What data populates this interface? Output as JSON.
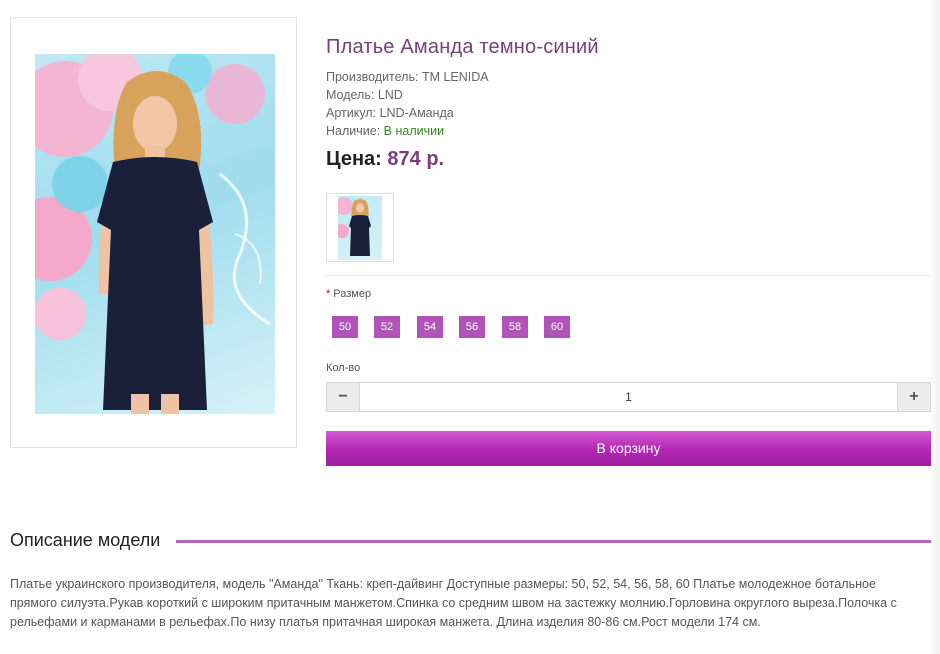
{
  "product": {
    "title": "Платье Аманда темно-синий",
    "specs": [
      {
        "label": "Производитель:",
        "value": "TM LENIDA"
      },
      {
        "label": "Модель:",
        "value": "LND"
      },
      {
        "label": "Артикул:",
        "value": "LND-Аманда"
      },
      {
        "label": "Наличие:",
        "value": "В наличии"
      }
    ],
    "price_label": "Цена:",
    "price_value": "874 р.",
    "size_label": "Размер",
    "sizes": [
      "50",
      "52",
      "54",
      "56",
      "58",
      "60"
    ],
    "qty_label": "Кол-во",
    "qty_value": "1",
    "qty_minus": "−",
    "qty_plus": "+",
    "cart_label": "В корзину"
  },
  "description": {
    "heading": "Описание модели",
    "text": "Платье украинского производителя, модель \"Аманда\" Ткань: креп-дайвинг Доступные размеры: 50, 52, 54, 56, 58, 60 Платье молодежное ботальное прямого силуэта.Рукав короткий с широким притачным манжетом.Спинка со средним швом на застежку молнию.Горловина округлого выреза.Полочка с рельефами и карманами в рельефах.По низу платья притачная широкая манжета. Длина изделия 80-86 см.Рост модели 174 см."
  },
  "colors": {
    "accent": "#7a3d7e",
    "size_button": "#b153b9",
    "cart_button": "#b52ab4",
    "in_stock": "#2e8b1f",
    "divider": "#b367b8"
  }
}
